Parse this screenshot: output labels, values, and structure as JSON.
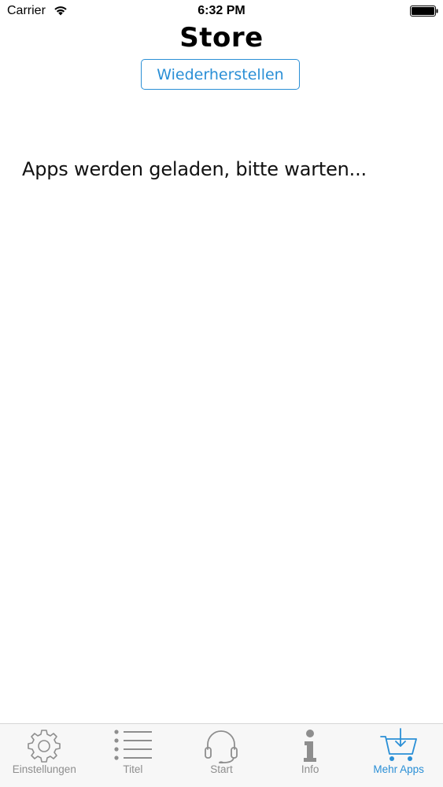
{
  "status_bar": {
    "carrier": "Carrier",
    "time": "6:32 PM"
  },
  "header": {
    "title": "Store",
    "restore_label": "Wiederherstellen"
  },
  "main": {
    "loading_text": "Apps werden geladen, bitte warten..."
  },
  "tab_bar": {
    "active_tab": "Mehr Apps",
    "items": [
      {
        "label": "Einstellungen",
        "icon": "gear-icon"
      },
      {
        "label": "Titel",
        "icon": "list-icon"
      },
      {
        "label": "Start",
        "icon": "headset-icon"
      },
      {
        "label": "Info",
        "icon": "info-icon"
      },
      {
        "label": "Mehr Apps",
        "icon": "cart-download-icon"
      }
    ]
  },
  "colors": {
    "accent": "#2a8fd6",
    "inactive": "#8e8e8e",
    "tab_bar_background": "#f7f7f7"
  }
}
